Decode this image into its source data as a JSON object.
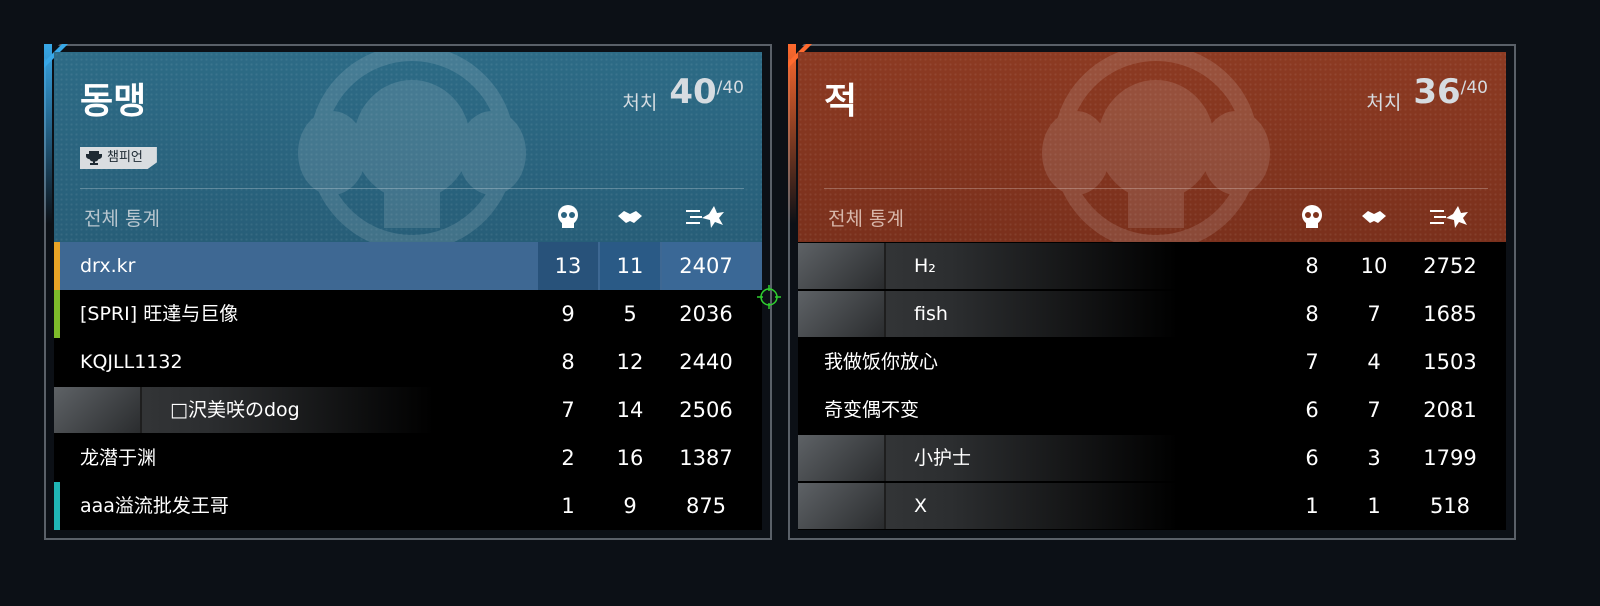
{
  "ally": {
    "team_name": "동맹",
    "kills_label": "처치",
    "kills": "40",
    "kills_total": "/40",
    "badge": "챔피언",
    "stats_label": "전체 통계",
    "accent_color": "#38a8e8",
    "players": [
      {
        "name": "drx.kr",
        "kills": "13",
        "assists": "11",
        "damage": "2407",
        "highlight": true,
        "bar_color": "#e9a426",
        "portrait": false
      },
      {
        "name": "[SPRI] 旺達与巨像",
        "kills": "9",
        "assists": "5",
        "damage": "2036",
        "highlight": false,
        "bar_color": "#7dbb2a",
        "portrait": false
      },
      {
        "name": "KQJLL1132",
        "kills": "8",
        "assists": "12",
        "damage": "2440",
        "highlight": false,
        "bar_color": "",
        "portrait": false
      },
      {
        "name": "□沢美咲のdog",
        "kills": "7",
        "assists": "14",
        "damage": "2506",
        "highlight": false,
        "bar_color": "",
        "portrait": true
      },
      {
        "name": "龙潜于渊",
        "kills": "2",
        "assists": "16",
        "damage": "1387",
        "highlight": false,
        "bar_color": "",
        "portrait": false
      },
      {
        "name": "aaa溢流批发王哥",
        "kills": "1",
        "assists": "9",
        "damage": "875",
        "highlight": false,
        "bar_color": "#1fb5b5",
        "portrait": false
      }
    ]
  },
  "enemy": {
    "team_name": "적",
    "kills_label": "처치",
    "kills": "36",
    "kills_total": "/40",
    "stats_label": "전체 통계",
    "accent_color": "#ff6a2e",
    "players": [
      {
        "name": "H₂",
        "kills": "8",
        "assists": "10",
        "damage": "2752",
        "portrait": true
      },
      {
        "name": "fish",
        "kills": "8",
        "assists": "7",
        "damage": "1685",
        "portrait": true
      },
      {
        "name": "我做饭你放心",
        "kills": "7",
        "assists": "4",
        "damage": "1503",
        "portrait": false
      },
      {
        "name": "奇变偶不变",
        "kills": "6",
        "assists": "7",
        "damage": "2081",
        "portrait": false
      },
      {
        "name": "小护士",
        "kills": "6",
        "assists": "3",
        "damage": "1799",
        "portrait": true
      },
      {
        "name": "X",
        "kills": "1",
        "assists": "1",
        "damage": "518",
        "portrait": true
      }
    ]
  },
  "icons": {
    "kills_column": "skull-icon",
    "assists_column": "handshake-icon",
    "damage_column": "damage-burst-icon",
    "badge": "trophy-icon"
  }
}
